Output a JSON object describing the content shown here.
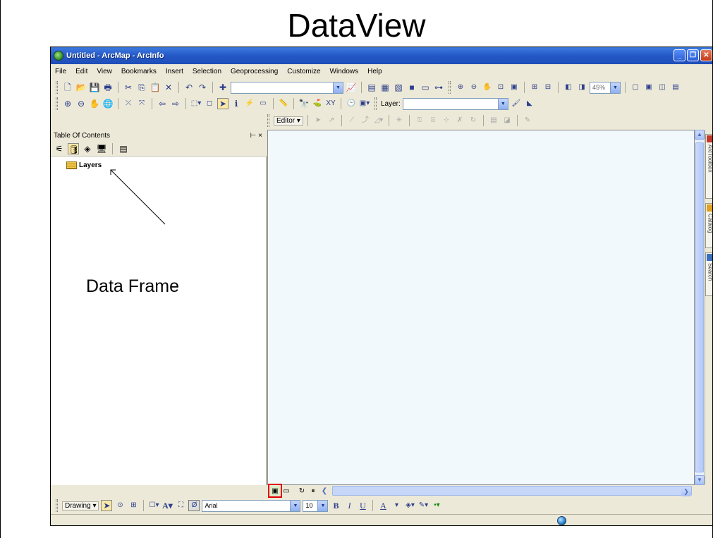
{
  "slide": {
    "title": "DataView",
    "annotation": "Data Frame"
  },
  "window": {
    "title": "Untitled - ArcMap - ArcInfo"
  },
  "menu": [
    "File",
    "Edit",
    "View",
    "Bookmarks",
    "Insert",
    "Selection",
    "Geoprocessing",
    "Customize",
    "Windows",
    "Help"
  ],
  "toolbar": {
    "zoom_percent": "45%",
    "layer_label": "Layer:",
    "editor_label": "Editor ▾"
  },
  "toc": {
    "title": "Table Of Contents",
    "pin_close": "⊢ ×",
    "layers_label": "Layers"
  },
  "side_tabs": [
    "ArcToolbox",
    "Catalog",
    "Search"
  ],
  "drawing": {
    "label": "Drawing ▾",
    "font_name": "Arial",
    "font_size": "10",
    "bold": "B",
    "italic": "I",
    "underline": "U",
    "font_color_letter": "A"
  },
  "colors": {
    "title_bar": "#2457c6",
    "highlight_box": "#e00000",
    "map_background": "#f1f9fc"
  }
}
